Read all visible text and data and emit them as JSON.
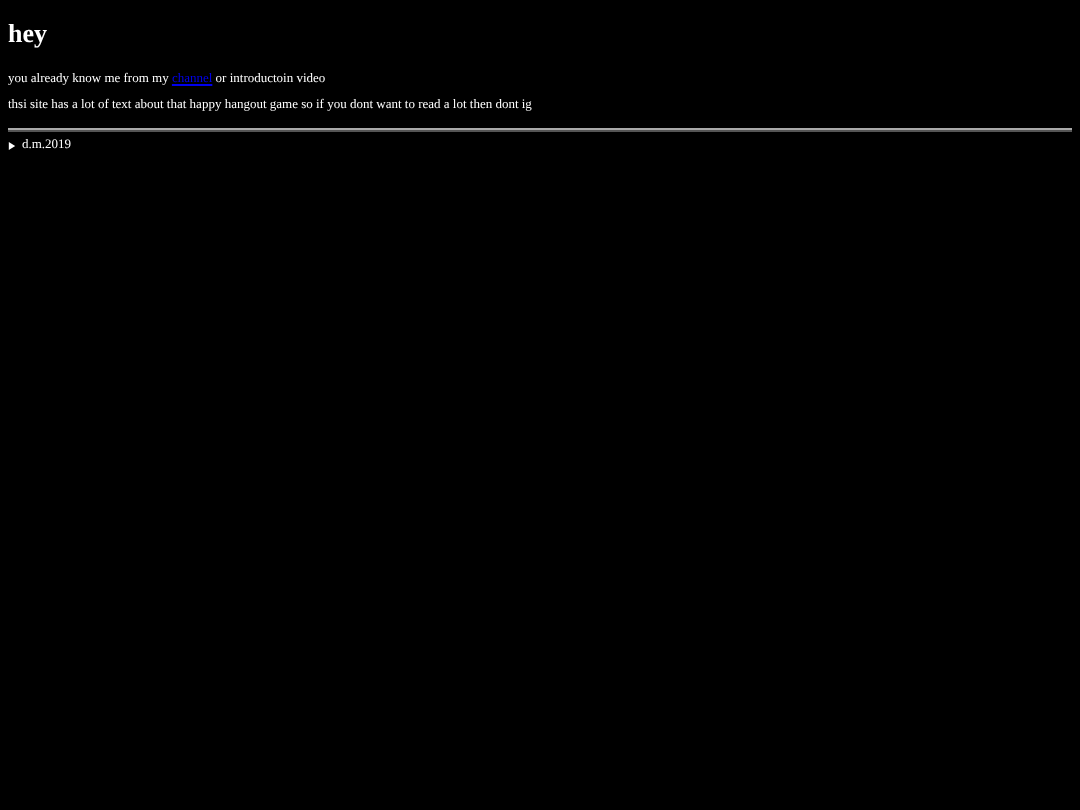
{
  "heading": "hey",
  "intro": {
    "before": "you already know me from my",
    "link": "channel",
    "after": "or introductoin video"
  },
  "note": "thsi site has a lot of text about that happy hangout game so if you dont want to read a lot then dont ig",
  "details": [
    {
      "summary": "d.m.2019",
      "expanded": false
    }
  ]
}
